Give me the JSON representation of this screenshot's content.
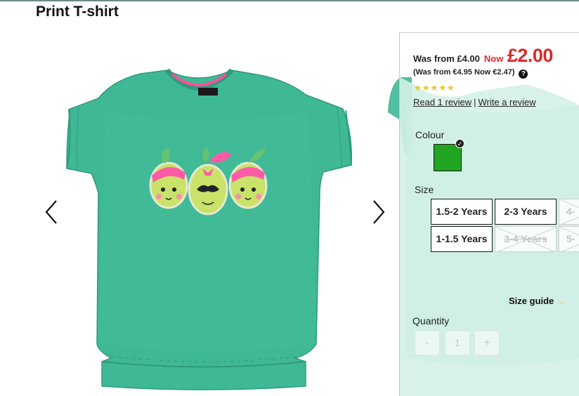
{
  "product": {
    "title": "Print T-shirt"
  },
  "price": {
    "was_text": "Was from £4.00",
    "now_label": "Now",
    "now_price": "£2.00",
    "euro_text": "(Was from €4.95 Now €2.47)",
    "help_glyph": "?",
    "sale_color": "#d92a2a"
  },
  "rating": {
    "stars": "★★★★★",
    "stars_value": 5,
    "read_review": "Read 1 review",
    "separator": "|",
    "write_review": "Write a review"
  },
  "colour": {
    "label": "Colour",
    "selected_hex": "#22a522",
    "check_glyph": "✓"
  },
  "size": {
    "label": "Size",
    "options": [
      {
        "label": "1.5-2 Years",
        "available": true
      },
      {
        "label": "2-3 Years",
        "available": true
      },
      {
        "label": "4-",
        "available": false
      },
      {
        "label": "1-1.5 Years",
        "available": true
      },
      {
        "label": "3-4 Years",
        "available": false
      },
      {
        "label": "5-",
        "available": false
      }
    ],
    "guide_label": "Size guide",
    "guide_glyph": "→"
  },
  "quantity": {
    "label": "Quantity",
    "minus": "-",
    "value": "1",
    "plus": "+"
  },
  "gallery": {
    "prev_icon": "chevron-left-icon",
    "next_icon": "chevron-right-icon"
  }
}
